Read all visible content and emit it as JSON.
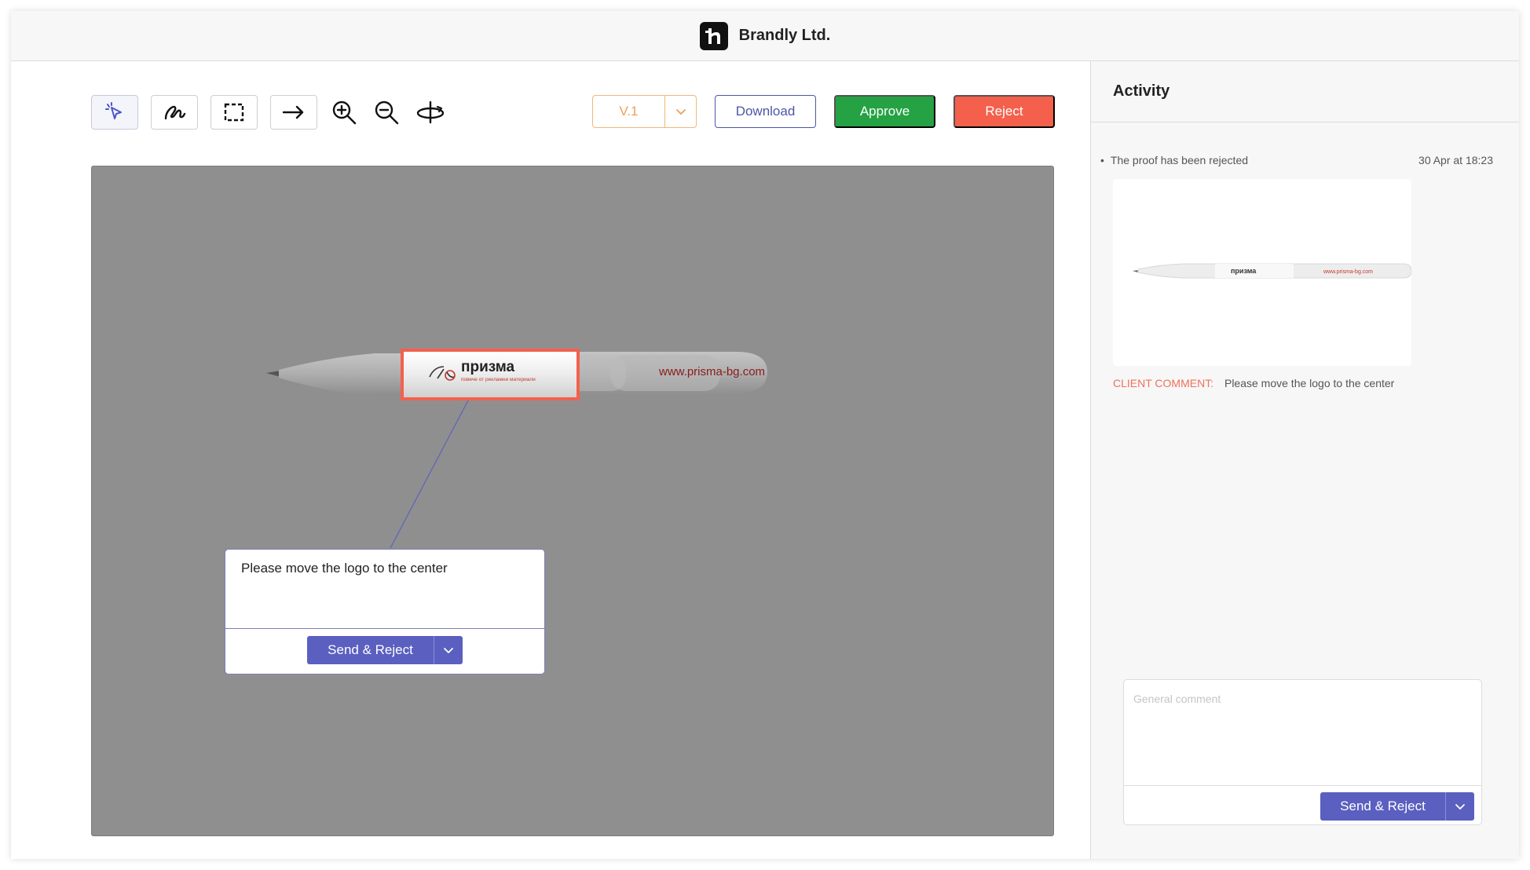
{
  "header": {
    "brand_name": "Brandly Ltd."
  },
  "toolbar": {
    "tools": [
      "select-icon",
      "draw-icon",
      "rectangle-select-icon",
      "arrow-icon",
      "zoom-in-icon",
      "zoom-out-icon",
      "rotate-icon"
    ],
    "version_label": "V.1",
    "download_label": "Download",
    "approve_label": "Approve",
    "reject_label": "Reject"
  },
  "canvas": {
    "pen_logo_text": "призма",
    "pen_logo_subtext": "повече от рекламни материали",
    "pen_url": "www.prisma-bg.com",
    "comment_text": "Please move the logo to the center",
    "send_reject_label": "Send & Reject"
  },
  "sidebar": {
    "title": "Activity",
    "activity": {
      "text": "The proof has been rejected",
      "time": "30 Apr at 18:23",
      "client_comment_label": "CLIENT COMMENT:",
      "client_comment_text": "Please move the logo to the center"
    },
    "general_comment_placeholder": "General comment",
    "send_reject_label": "Send & Reject"
  },
  "colors": {
    "approve": "#25a244",
    "reject": "#f4604c",
    "primary": "#5a5fc0",
    "version": "#e8a15a"
  }
}
